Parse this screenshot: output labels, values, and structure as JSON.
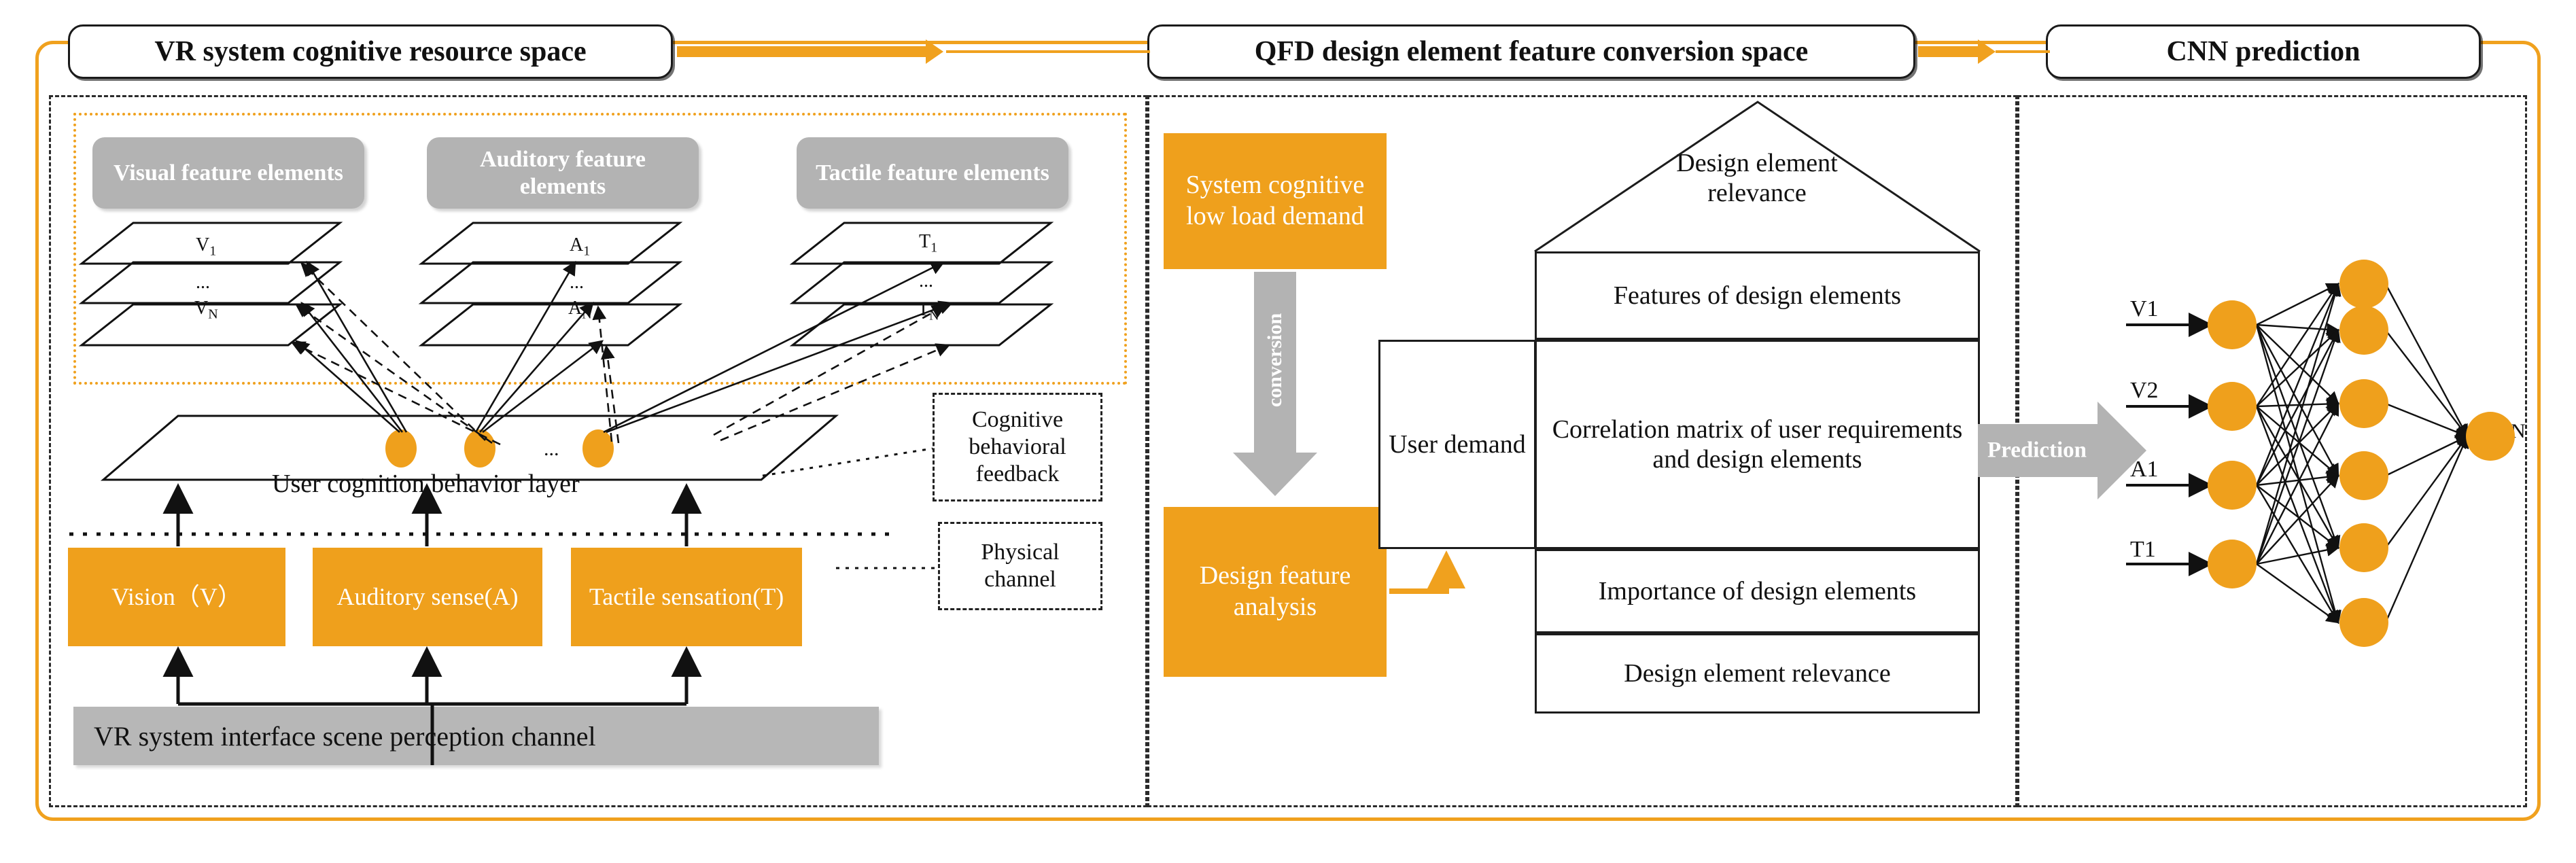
{
  "colors": {
    "accent": "#F0A11E",
    "orange_box": "#EFA01C",
    "gray_box": "#B3B3B3",
    "gray_bar": "#B7B7B7",
    "ink": "#111111"
  },
  "headers": [
    {
      "id": "vr-space",
      "label": "VR system cognitive resource space"
    },
    {
      "id": "qfd-space",
      "label": "QFD design element feature conversion space"
    },
    {
      "id": "cnn-space",
      "label": "CNN prediction"
    }
  ],
  "left_panel": {
    "feature_groups": [
      {
        "id": "visual",
        "title": "Visual feature elements",
        "top_label": "V",
        "top_sub": "1",
        "bottom_label": "V",
        "bottom_sub": "N",
        "ellipsis": "..."
      },
      {
        "id": "auditory",
        "title": "Auditory feature elements",
        "top_label": "A",
        "top_sub": "1",
        "bottom_label": "A",
        "bottom_sub": "N",
        "ellipsis": "..."
      },
      {
        "id": "tactile",
        "title": "Tactile feature elements",
        "top_label": "T",
        "top_sub": "1",
        "bottom_label": "T",
        "bottom_sub": "N",
        "ellipsis": "..."
      }
    ],
    "cognition_layer_label": "User cognition behavior layer",
    "side_boxes": [
      {
        "id": "feedback",
        "label": "Cognitive behavioral feedback"
      },
      {
        "id": "physical",
        "label": "Physical channel"
      }
    ],
    "sense_boxes": [
      {
        "id": "vision",
        "label": "Vision（V）"
      },
      {
        "id": "auditory-sense",
        "label": "Auditory sense(A)"
      },
      {
        "id": "tactile-sense",
        "label": "Tactile sensation(T)"
      }
    ],
    "perception_channel_label": "VR system interface scene perception channel"
  },
  "middle_panel": {
    "demand_box": "System cognitive low load demand",
    "conversion_label": "conversion",
    "analysis_box": "Design feature analysis",
    "house": {
      "roof": "Design element relevance",
      "features": "Features of design elements",
      "user_demand": "User demand",
      "matrix": "Correlation matrix of user requirements and design elements",
      "importance": "Importance of design elements",
      "relevance": "Design element relevance"
    }
  },
  "right_panel": {
    "prediction_label": "Prediction",
    "inputs": [
      "V1",
      "V2",
      "A1",
      "T1"
    ],
    "output": "N",
    "hidden_count": 6
  }
}
